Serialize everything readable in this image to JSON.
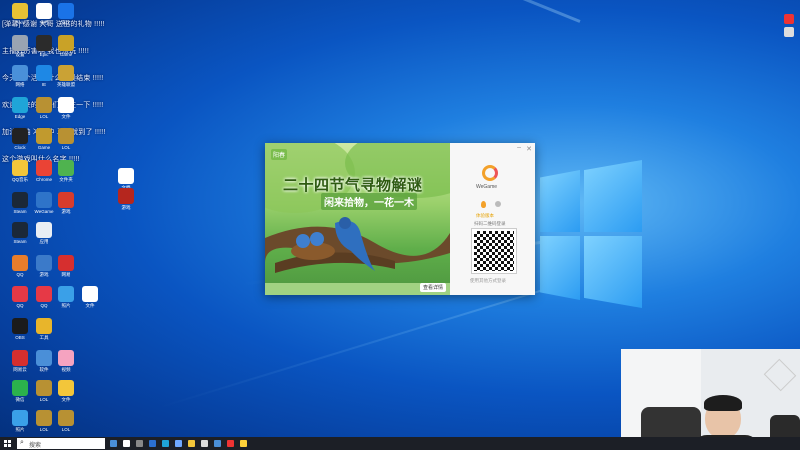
{
  "overlay_lines": [
    "[弹幕] 感谢 大哥 送出的礼物 !!!!!",
    "主播好厉害啊 我也想玩 !!!!!",
    "今天这个活动 什么时候结束 !!!!!",
    "欢迎新来的朋友们 关注一下 !!!!!",
    "加油加油 冲冲冲 马上就到了 !!!!!",
    "这个游戏叫什么名字 !!!!!"
  ],
  "desktop_icons": [
    {
      "label": "Pixiv",
      "color": "#e8c234"
    },
    {
      "label": "文档",
      "color": "#ffffff"
    },
    {
      "label": "安全",
      "color": "#1a73e8"
    },
    {
      "label": "设置",
      "color": "#9aa4b2"
    },
    {
      "label": "Epic",
      "color": "#2b2b2b"
    },
    {
      "label": "Game",
      "color": "#c9a227"
    },
    {
      "label": "网络",
      "color": "#4a90d9"
    },
    {
      "label": "IE",
      "color": "#1e88e5"
    },
    {
      "label": "英雄联盟",
      "color": "#caa235"
    },
    {
      "label": "Edge",
      "color": "#1fa5d8"
    },
    {
      "label": "LOL",
      "color": "#b89133"
    },
    {
      "label": "文件",
      "color": "#ffffff"
    },
    {
      "label": "Clock",
      "color": "#222"
    },
    {
      "label": "Game",
      "color": "#c19a2e"
    },
    {
      "label": "LOL",
      "color": "#b89133"
    },
    {
      "label": "QQ音乐",
      "color": "#f3c63a"
    },
    {
      "label": "Chrome",
      "color": "#ea4335"
    },
    {
      "label": "文件夹",
      "color": "#4fb34f"
    },
    {
      "label": "Steam",
      "color": "#1b2838"
    },
    {
      "label": "WeGame",
      "color": "#2e74c9"
    },
    {
      "label": "游戏",
      "color": "#d73c2c"
    },
    {
      "label": "Steam",
      "color": "#1b2838"
    },
    {
      "label": "应用",
      "color": "#e9eef4"
    },
    {
      "label": "QQ",
      "color": "#e87d2b"
    },
    {
      "label": "游戏",
      "color": "#3b7ac9"
    },
    {
      "label": "网易",
      "color": "#d62f2f"
    },
    {
      "label": "QQ",
      "color": "#e63946"
    },
    {
      "label": "QQ",
      "color": "#e63946"
    },
    {
      "label": "照片",
      "color": "#3aa0e8"
    },
    {
      "label": "文件",
      "color": "#ffffff"
    },
    {
      "label": "OBS",
      "color": "#1b1b1b"
    },
    {
      "label": "工具",
      "color": "#e8b52b"
    },
    {
      "label": "网易云",
      "color": "#d62f2f"
    },
    {
      "label": "软件",
      "color": "#4a8fd8"
    },
    {
      "label": "视频",
      "color": "#f5a3c0"
    },
    {
      "label": "微信",
      "color": "#2bb24c"
    },
    {
      "label": "LOL",
      "color": "#b89133"
    },
    {
      "label": "文件",
      "color": "#f3c63a"
    },
    {
      "label": "照片",
      "color": "#3aa0e8"
    },
    {
      "label": "LOL",
      "color": "#b89133"
    },
    {
      "label": "LOL",
      "color": "#b89133"
    }
  ],
  "extra_icons": [
    {
      "label": "文档",
      "color": "#ffffff"
    },
    {
      "label": "游戏",
      "color": "#b5261e"
    }
  ],
  "popup": {
    "title": "二十四节气寻物解谜",
    "subtitle": "闲来拾物，一花一木",
    "logo_text": "WeGame",
    "small_tag": "阳春",
    "bottom_button": "查看详情",
    "qr_caption": "扫码二维码登录",
    "side_link": "使用其他方式登录",
    "yellow_text": "体验版本"
  },
  "taskbar": {
    "search": "搜索"
  }
}
